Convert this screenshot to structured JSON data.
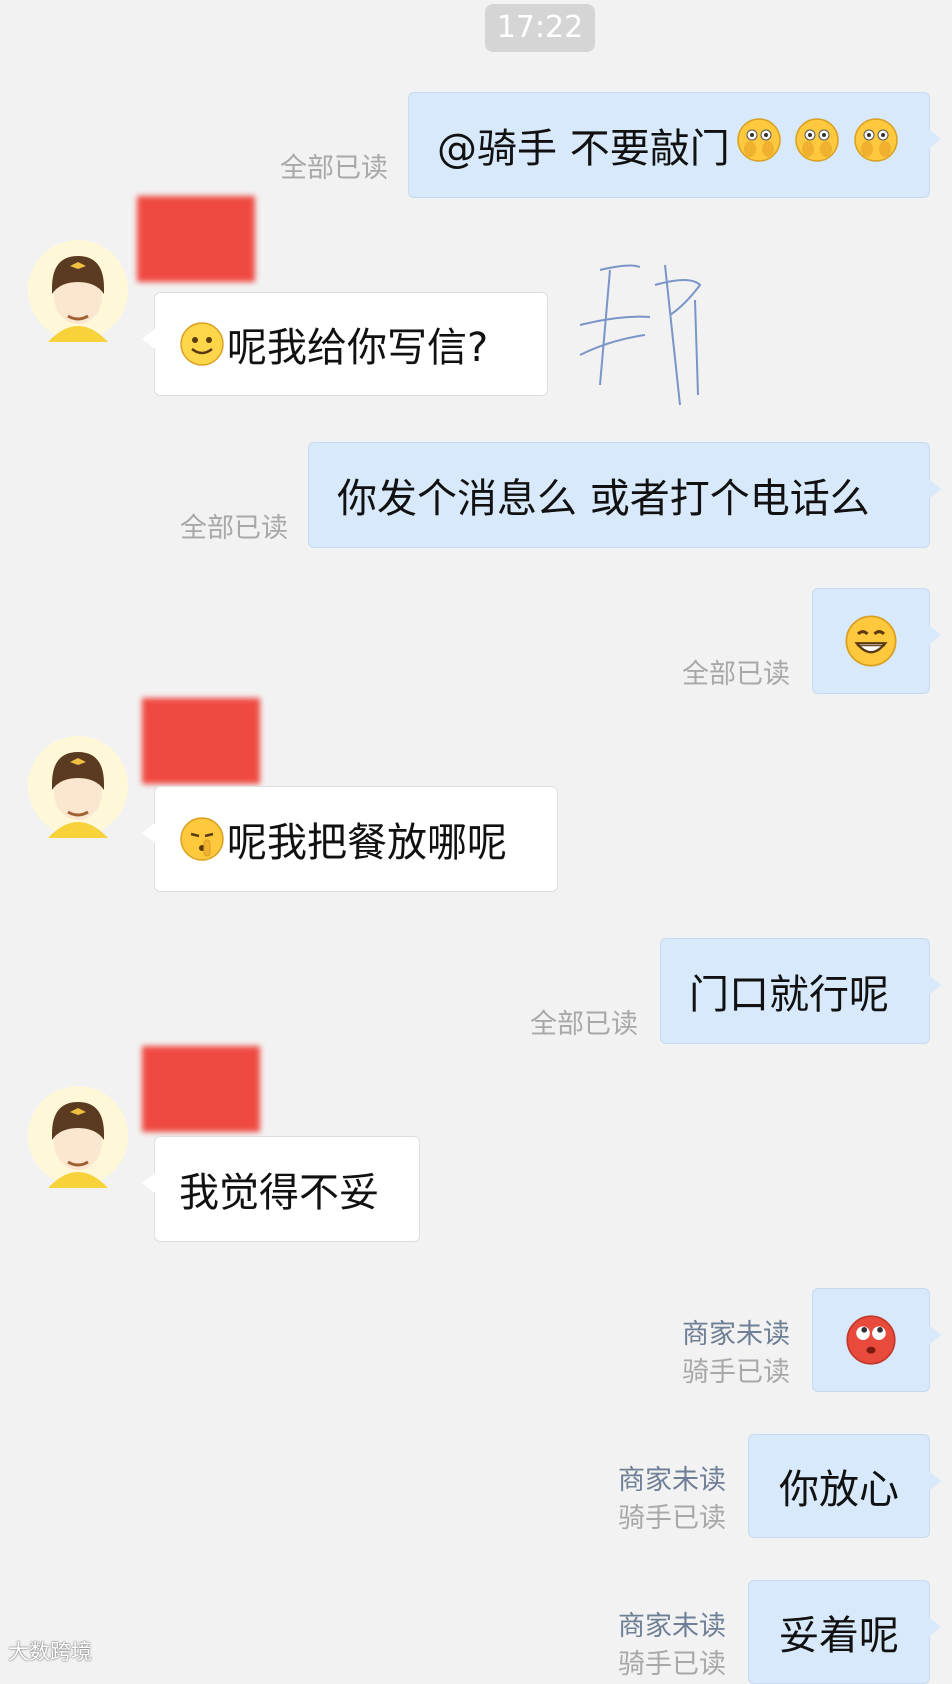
{
  "time": "17:22",
  "messages": [
    {
      "from": "me",
      "text": "@骑手 不要敲门",
      "status": "全部已读"
    },
    {
      "from": "rider",
      "text": "呢我给你写信?"
    },
    {
      "from": "me",
      "text": "你发个消息么 或者打个电话么",
      "status": "全部已读"
    },
    {
      "from": "me",
      "text": "",
      "status": "全部已读"
    },
    {
      "from": "rider",
      "text": "呢我把餐放哪呢"
    },
    {
      "from": "me",
      "text": "门口就行呢",
      "status": "全部已读"
    },
    {
      "from": "rider",
      "text": "我觉得不妥"
    },
    {
      "from": "me",
      "text": "",
      "status_unread": "商家未读",
      "status_read": "骑手已读"
    },
    {
      "from": "me",
      "text": "你放心",
      "status_unread": "商家未读",
      "status_read": "骑手已读"
    },
    {
      "from": "me",
      "text": "妥着呢",
      "status_unread": "商家未读",
      "status_read": "骑手已读"
    }
  ],
  "handwritten_note": "那",
  "watermark": "大数跨境",
  "colors": {
    "background": "#f2f2f2",
    "outgoing_bubble": "#d7e9fa",
    "incoming_bubble": "#ffffff",
    "read_text": "#a8a8a8",
    "unread_text": "#6f7f96",
    "redaction": "#ef4a42"
  },
  "icons": {
    "emoji_1": "surprised-cover-mouth-emoji",
    "emoji_2": "smile-emoji",
    "emoji_3": "grin-emoji",
    "emoji_4": "shush-emoji",
    "emoji_5": "eye-roll-red-emoji",
    "avatar": "rider-avatar-helmet"
  }
}
